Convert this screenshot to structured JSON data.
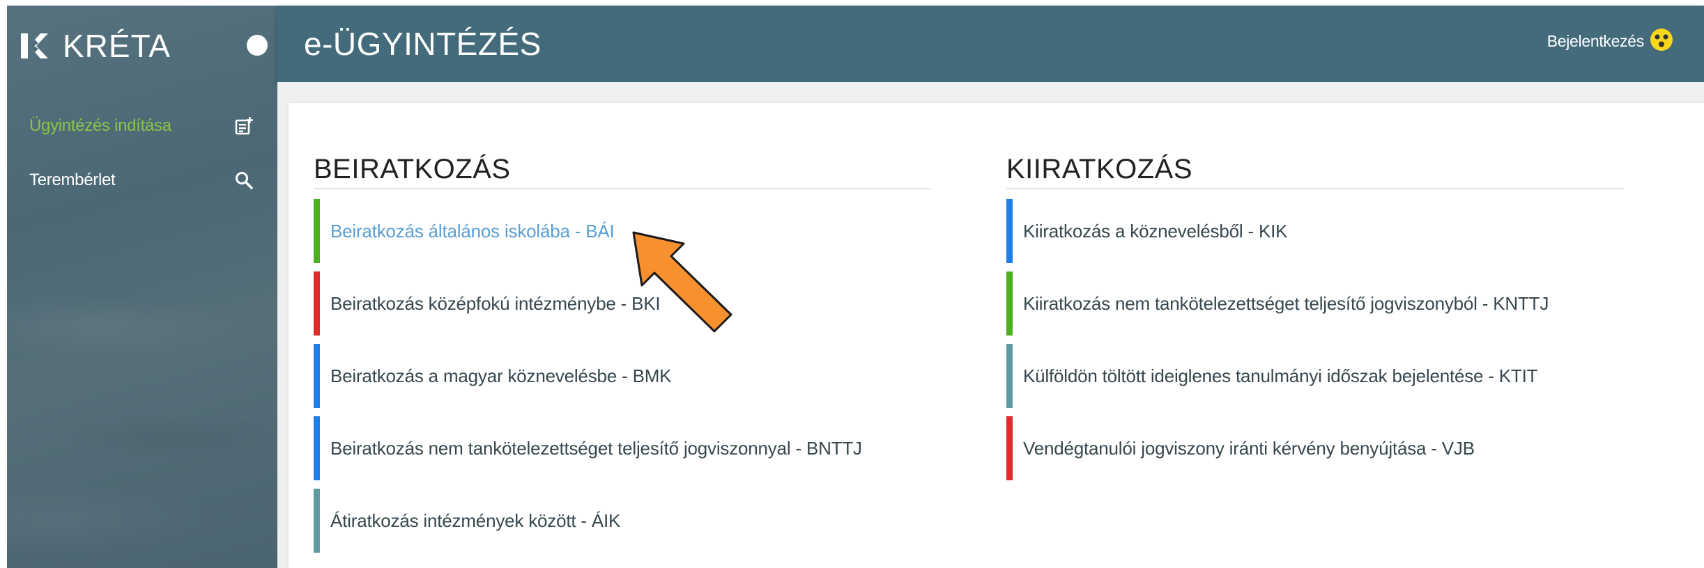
{
  "brand": {
    "name": "KRÉTA",
    "logo_icon": "kreta-k-logo-icon"
  },
  "sidebar": {
    "items": [
      {
        "label": "Ügyintézés indítása",
        "icon": "new-document-icon",
        "active": true
      },
      {
        "label": "Terembérlet",
        "icon": "search-icon",
        "active": false
      }
    ]
  },
  "header": {
    "title": "e-ÜGYINTÉZÉS",
    "login_label": "Bejelentkezés",
    "login_icon": "smiley-face-icon"
  },
  "sections": {
    "enrollment": {
      "title": "BEIRATKOZÁS",
      "items": [
        {
          "label": "Beiratkozás általános iskolába - BÁI",
          "color": "#4caf1e"
        },
        {
          "label": "Beiratkozás középfokú intézménybe - BKI",
          "color": "#e02b2b"
        },
        {
          "label": "Beiratkozás a magyar köznevelésbe - BMK",
          "color": "#1e7ee8"
        },
        {
          "label": "Beiratkozás nem tankötelezettséget teljesítő jogviszonnyal - BNTTJ",
          "color": "#1e7ee8"
        },
        {
          "label": "Átiratkozás intézmények között - ÁIK",
          "color": "#5f9aa0"
        }
      ]
    },
    "withdrawal": {
      "title": "KIIRATKOZÁS",
      "items": [
        {
          "label": "Kiiratkozás a köznevelésből - KIK",
          "color": "#1e7ee8"
        },
        {
          "label": "Kiiratkozás nem tankötelezettséget teljesítő jogviszonyból - KNTTJ",
          "color": "#4caf1e"
        },
        {
          "label": "Külföldön töltött ideiglenes tanulmányi időszak bejelentése - KTIT",
          "color": "#5f9aa0"
        },
        {
          "label": "Vendégtanulói jogviszony iránti kérvény benyújtása - VJB",
          "color": "#e02b2b"
        }
      ]
    }
  },
  "colors": {
    "sidebar": "#4e6b77",
    "header": "#436b7c",
    "active_nav": "#8bc34a",
    "highlight_link": "#5a9fd4",
    "arrow": "#f7902f"
  }
}
